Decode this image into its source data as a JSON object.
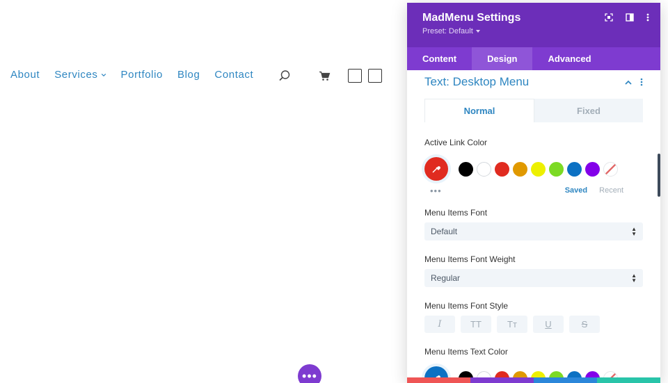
{
  "nav": {
    "items": [
      "About",
      "Services",
      "Portfolio",
      "Blog",
      "Contact"
    ]
  },
  "panel": {
    "title": "MadMenu Settings",
    "preset": "Preset: Default",
    "tabs": [
      "Content",
      "Design",
      "Advanced"
    ],
    "active_tab": "Design",
    "section_title": "Text: Desktop Menu",
    "subtabs": [
      "Normal",
      "Fixed"
    ],
    "active_subtab": "Normal",
    "active_link_color": {
      "label": "Active Link Color",
      "selected": "#e02b20",
      "swatches": [
        "#000000",
        "#ffffff",
        "#e02b20",
        "#e09900",
        "#edf000",
        "#7cda24",
        "#0c71c3",
        "#8300e9"
      ],
      "more": "•••",
      "saved": "Saved",
      "recent": "Recent"
    },
    "menu_items_font": {
      "label": "Menu Items Font",
      "value": "Default"
    },
    "menu_items_font_weight": {
      "label": "Menu Items Font Weight",
      "value": "Regular"
    },
    "menu_items_font_style": {
      "label": "Menu Items Font Style",
      "buttons": [
        "I",
        "TT",
        "Tт",
        "U",
        "S"
      ]
    },
    "menu_items_text_color": {
      "label": "Menu Items Text Color",
      "selected": "#0c71c3",
      "swatches": [
        "#000000",
        "#ffffff",
        "#e02b20",
        "#e09900",
        "#edf000",
        "#7cda24",
        "#0c71c3",
        "#8300e9"
      ]
    },
    "bottom_bar_colors": [
      "#ef5555",
      "#7e3bd0",
      "#2b87da",
      "#29c4a9"
    ]
  },
  "colors": {
    "accent": "#2e86c1",
    "panel_header": "#6c2eb9",
    "tabs_bg": "#7e3bd0"
  },
  "fab": {
    "label": "•••"
  }
}
